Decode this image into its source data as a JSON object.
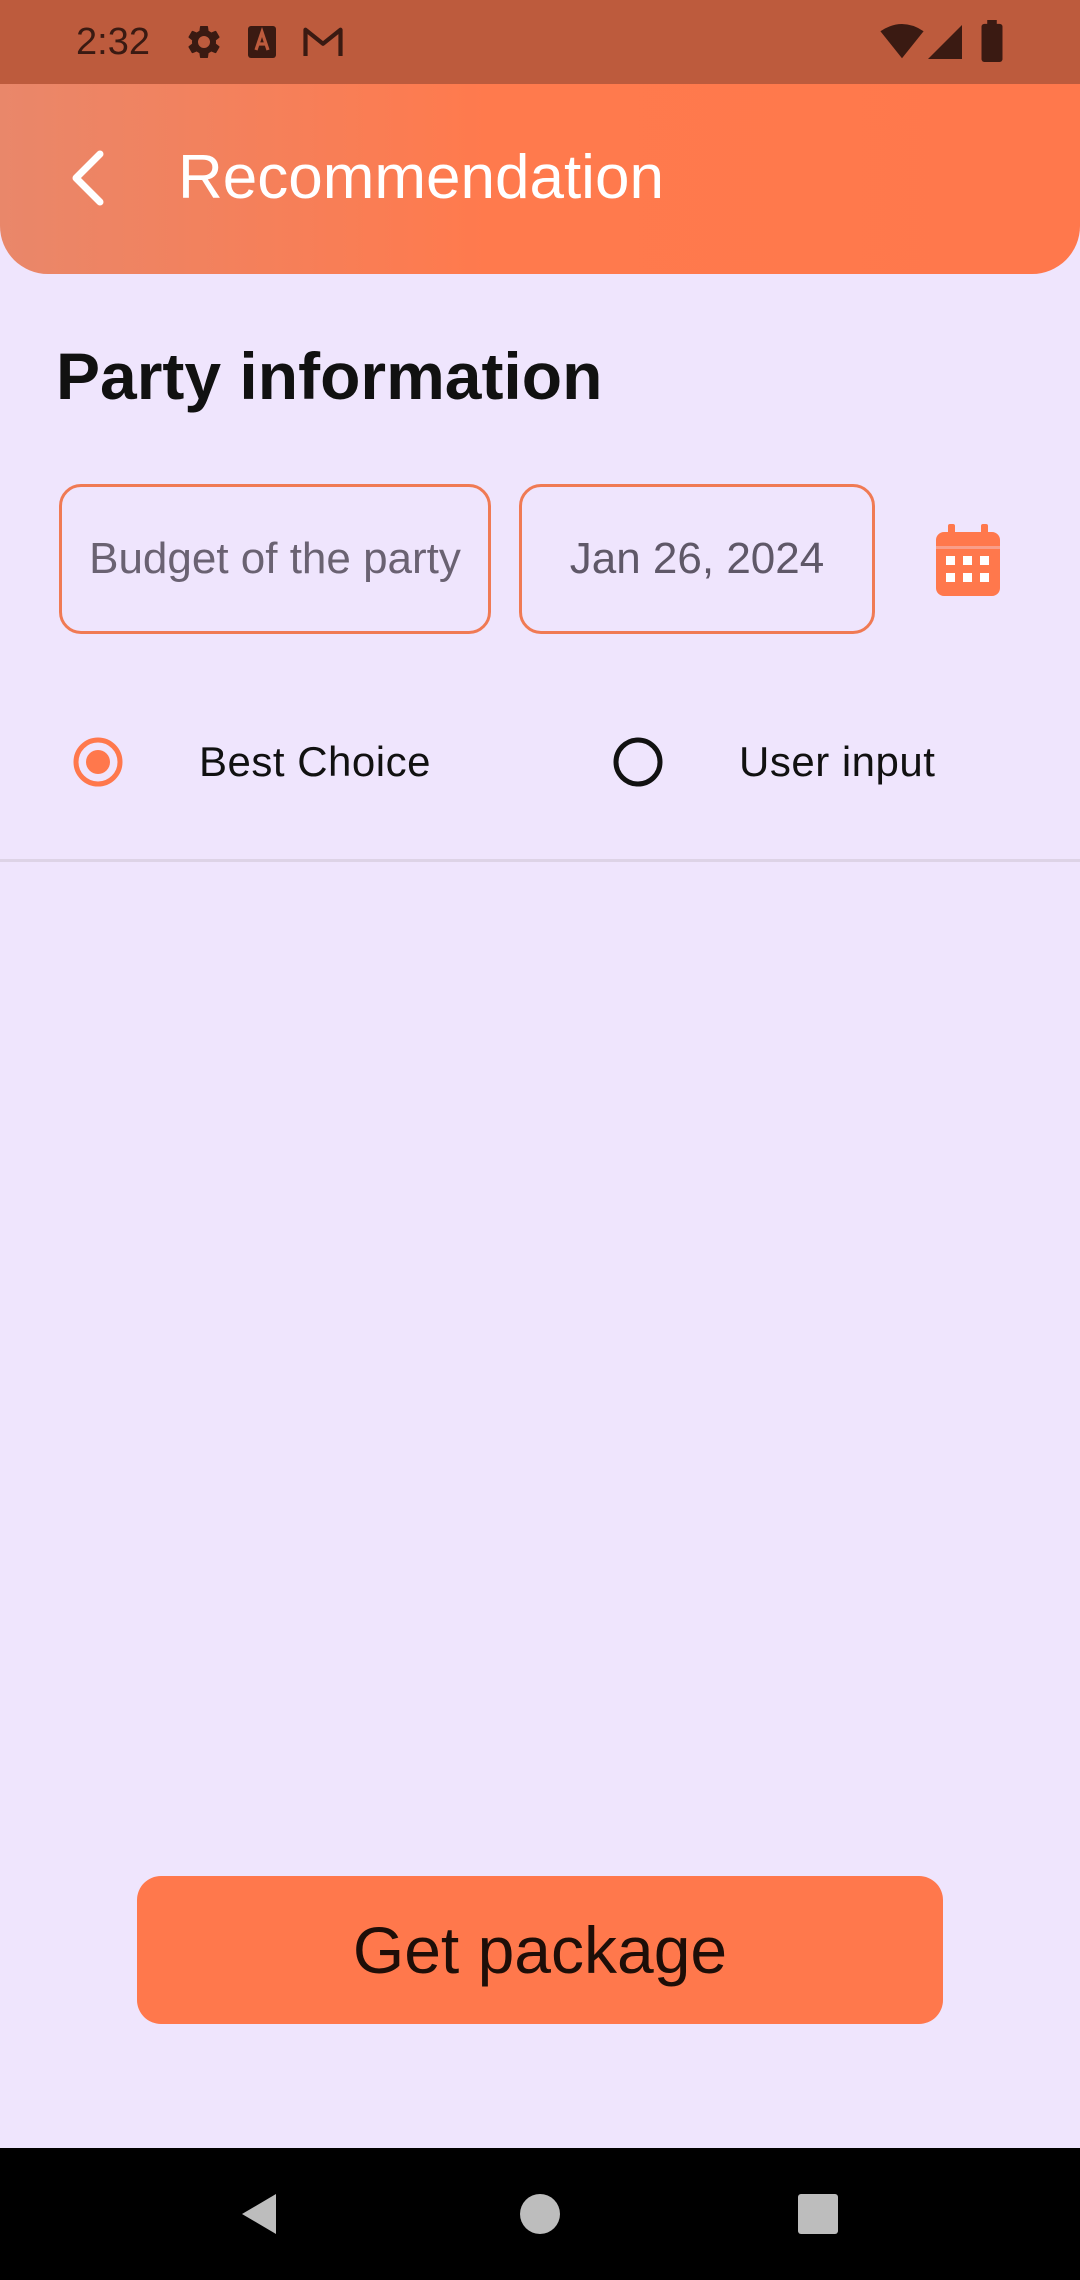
{
  "status_bar": {
    "time": "2:32",
    "left_icons": [
      "gear-icon",
      "font-a-icon",
      "gmail-icon"
    ],
    "right_icons": [
      "wifi-icon",
      "cell-signal-icon",
      "battery-icon"
    ]
  },
  "app_bar": {
    "title": "Recommendation",
    "back_icon": "chevron-left-icon"
  },
  "section": {
    "title": "Party information"
  },
  "inputs": {
    "budget_placeholder": "Budget of the party",
    "date_value": "Jan 26, 2024",
    "calendar_icon": "calendar-icon"
  },
  "radio_options": {
    "best_choice_label": "Best Choice",
    "best_choice_selected": true,
    "user_input_label": "User input",
    "user_input_selected": false
  },
  "actions": {
    "get_package_label": "Get package"
  },
  "nav": {
    "back_icon": "nav-back-icon",
    "home_icon": "nav-home-icon",
    "recents_icon": "nav-recents-icon"
  },
  "colors": {
    "accent": "#FF784C",
    "background": "#EFE5FD",
    "status_bar": "#BD5B3D"
  }
}
